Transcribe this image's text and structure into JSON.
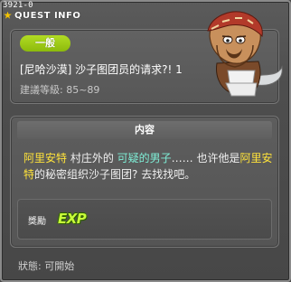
{
  "quest_id": "3921-0",
  "window": {
    "title": "QUEST INFO"
  },
  "header": {
    "category": "一般",
    "quest_name": "[尼哈沙漠] 沙子图团员的请求?! 1",
    "level_range": "建議等級: 85~89"
  },
  "content": {
    "section_title": "内容",
    "description": [
      {
        "text": "阿里安特",
        "style": "y"
      },
      {
        "text": " 村庄外的 ",
        "style": "n"
      },
      {
        "text": "可疑的男子",
        "style": "c"
      },
      {
        "text": "…… 也许他是",
        "style": "n"
      },
      {
        "text": "阿里安特",
        "style": "y"
      },
      {
        "text": "的秘密组织沙子图团? 去找找吧。",
        "style": "n"
      }
    ],
    "reward_label": "獎勵",
    "reward_type": "EXP"
  },
  "footer": {
    "status": "狀態: 可開始"
  },
  "icons": {
    "title": "star-icon",
    "npc": "npc-portrait",
    "reward": "exp-icon"
  },
  "colors": {
    "badge": "#a2cc1c",
    "highlight_name": "#ffe33a",
    "highlight_npc": "#7ff0d8",
    "exp": "#c8ff3a"
  }
}
